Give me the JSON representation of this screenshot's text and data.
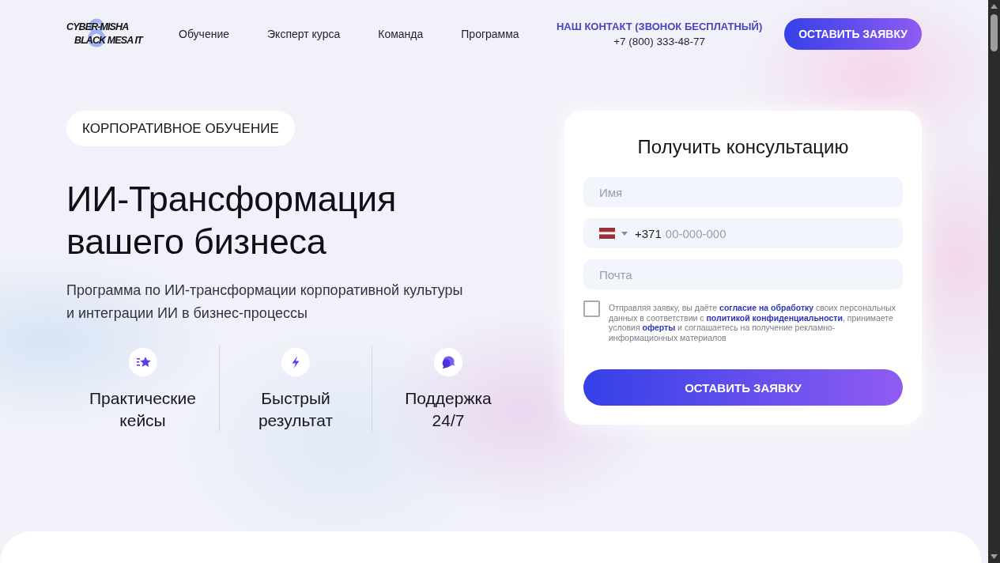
{
  "header": {
    "logo": {
      "top_line": "CYBER-MISHA",
      "bottom_line": "BLACK MESA IT"
    },
    "nav": [
      {
        "label": "Обучение"
      },
      {
        "label": "Эксперт курса"
      },
      {
        "label": "Команда"
      },
      {
        "label": "Программа"
      }
    ],
    "contact": {
      "title": "НАШ КОНТАКТ (ЗВОНОК БЕСПЛАТНЫЙ)",
      "phone": "+7 (800) 333-48-77"
    },
    "cta_button": "ОСТАВИТЬ ЗАЯВКУ"
  },
  "hero": {
    "badge": "КОРПОРАТИВНОЕ ОБУЧЕНИЕ",
    "title": "ИИ-Трансформация вашего бизнеса",
    "subtitle": "Программа по ИИ-трансформации корпоративной культуры и интеграции ИИ в бизнес-процессы",
    "features": [
      {
        "kind": "star",
        "label": "Практические кейсы"
      },
      {
        "kind": "lightning",
        "label": "Быстрый результат"
      },
      {
        "kind": "chat",
        "label": "Поддержка 24/7"
      }
    ]
  },
  "form": {
    "title": "Получить консультацию",
    "fields": [
      {
        "kind": "text",
        "placeholder": "Имя"
      },
      {
        "kind": "phone",
        "code": "+371",
        "placeholder": "00-000-000"
      },
      {
        "kind": "email",
        "placeholder": "Почта"
      }
    ],
    "consent": {
      "checked": false,
      "parts": [
        {
          "kind": "text",
          "text": "Отправляя заявку, вы даёте "
        },
        {
          "kind": "link",
          "text": "согласие на обработку"
        },
        {
          "kind": "text",
          "text": " своих персональных данных в соответствии с "
        },
        {
          "kind": "link",
          "text": "политикой конфиденциальности"
        },
        {
          "kind": "text",
          "text": ", принимаете условия "
        },
        {
          "kind": "link",
          "text": "оферты"
        },
        {
          "kind": "text",
          "text": " и соглашаетесь на получение рекламно-информационных материалов"
        }
      ]
    },
    "submit_button": "ОСТАВИТЬ ЗАЯВКУ"
  }
}
